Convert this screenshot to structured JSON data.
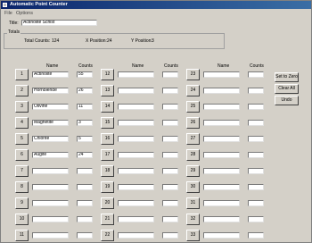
{
  "window": {
    "title": "Automatic Point Counter"
  },
  "menu": [
    "File",
    "Options"
  ],
  "title_field": {
    "label": "Title:",
    "value": "Actinolite Schist"
  },
  "totals": {
    "group_label": "Totals",
    "total_counts_label": "Total Counts:",
    "total_counts_value": "124",
    "x_position_label": "X Position:",
    "x_position_value": "24",
    "y_position_label": "Y Position:",
    "y_position_value": "3"
  },
  "columns": [
    {
      "name_header": "Name",
      "counts_header": "Counts",
      "rows": [
        {
          "num": "1",
          "name": "Actinolite",
          "count": "55"
        },
        {
          "num": "2",
          "name": "Hornblende",
          "count": "26"
        },
        {
          "num": "3",
          "name": "Olivine",
          "count": "11"
        },
        {
          "num": "4",
          "name": "Magnetite",
          "count": "3"
        },
        {
          "num": "5",
          "name": "Chlorite",
          "count": "5"
        },
        {
          "num": "6",
          "name": "Augite",
          "count": "24"
        },
        {
          "num": "7",
          "name": "",
          "count": ""
        },
        {
          "num": "8",
          "name": "",
          "count": ""
        },
        {
          "num": "9",
          "name": "",
          "count": ""
        },
        {
          "num": "10",
          "name": "",
          "count": ""
        },
        {
          "num": "11",
          "name": "",
          "count": ""
        }
      ]
    },
    {
      "name_header": "Name",
      "counts_header": "Counts",
      "rows": [
        {
          "num": "12",
          "name": "",
          "count": ""
        },
        {
          "num": "13",
          "name": "",
          "count": ""
        },
        {
          "num": "14",
          "name": "",
          "count": ""
        },
        {
          "num": "15",
          "name": "",
          "count": ""
        },
        {
          "num": "16",
          "name": "",
          "count": ""
        },
        {
          "num": "17",
          "name": "",
          "count": ""
        },
        {
          "num": "18",
          "name": "",
          "count": ""
        },
        {
          "num": "19",
          "name": "",
          "count": ""
        },
        {
          "num": "20",
          "name": "",
          "count": ""
        },
        {
          "num": "21",
          "name": "",
          "count": ""
        },
        {
          "num": "22",
          "name": "",
          "count": ""
        }
      ]
    },
    {
      "name_header": "Name",
      "counts_header": "Counts",
      "rows": [
        {
          "num": "23",
          "name": "",
          "count": ""
        },
        {
          "num": "24",
          "name": "",
          "count": ""
        },
        {
          "num": "25",
          "name": "",
          "count": ""
        },
        {
          "num": "26",
          "name": "",
          "count": ""
        },
        {
          "num": "27",
          "name": "",
          "count": ""
        },
        {
          "num": "28",
          "name": "",
          "count": ""
        },
        {
          "num": "29",
          "name": "",
          "count": ""
        },
        {
          "num": "30",
          "name": "",
          "count": ""
        },
        {
          "num": "31",
          "name": "",
          "count": ""
        },
        {
          "num": "32",
          "name": "",
          "count": ""
        },
        {
          "num": "33",
          "name": "",
          "count": ""
        }
      ]
    }
  ],
  "actions": {
    "set_to_zero": "Set to Zero",
    "clear_all": "Clear All",
    "undo": "Undo"
  }
}
